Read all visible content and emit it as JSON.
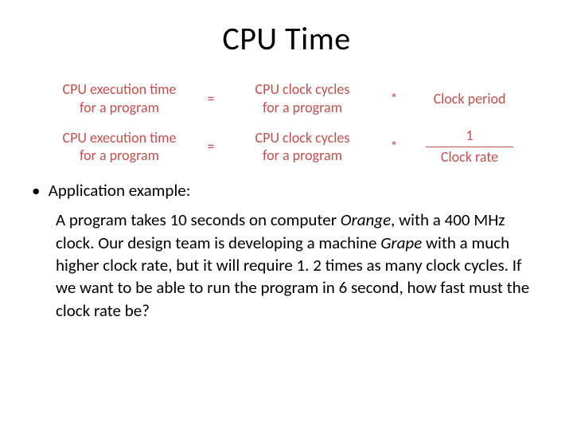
{
  "title": "CPU Time",
  "equations": [
    {
      "lhs_line1": "CPU execution time",
      "lhs_line2": "for a program",
      "eq": "=",
      "mid_line1": "CPU clock cycles",
      "mid_line2": "for a program",
      "op": "*",
      "rhs_type": "plain",
      "rhs_plain": "Clock period"
    },
    {
      "lhs_line1": "CPU execution time",
      "lhs_line2": "for a program",
      "eq": "=",
      "mid_line1": "CPU clock cycles",
      "mid_line2": "for a program",
      "op": "*",
      "rhs_type": "frac",
      "rhs_num": "1",
      "rhs_den": "Clock rate"
    }
  ],
  "bullet_label": "Application example:",
  "body": {
    "p1a": "A program takes 10 seconds on computer ",
    "p1_i1": "Orange",
    "p1b": ", with a 400 MHz clock.  Our design team is developing a machine ",
    "p1_i2": "Grape",
    "p1c": " with a much higher clock rate, but it will require 1. 2 times as many clock cycles.  If we want to be able to run the program in 6 second, how fast must the clock rate be?"
  }
}
